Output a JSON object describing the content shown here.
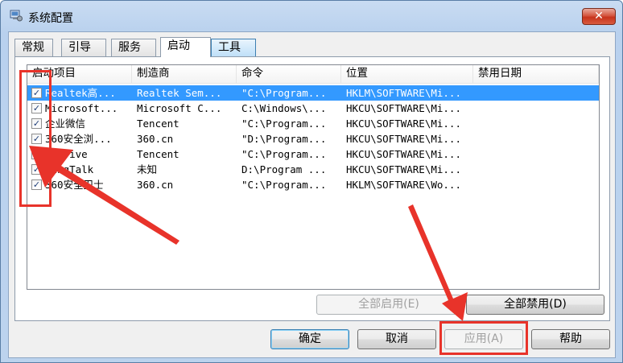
{
  "window": {
    "title": "系统配置",
    "close_label": "✕"
  },
  "tabs": [
    {
      "label": "常规"
    },
    {
      "label": "引导"
    },
    {
      "label": "服务"
    },
    {
      "label": "启动"
    },
    {
      "label": "工具"
    }
  ],
  "columns": [
    "启动项目",
    "制造商",
    "命令",
    "位置",
    "禁用日期"
  ],
  "rows": [
    {
      "item": "Realtek高...",
      "maker": "Realtek Sem...",
      "command": "\"C:\\Program...",
      "location": "HKLM\\SOFTWARE\\Mi...",
      "date": "",
      "checked": true,
      "selected": true
    },
    {
      "item": "Microsoft...",
      "maker": "Microsoft C...",
      "command": "C:\\Windows\\...",
      "location": "HKCU\\SOFTWARE\\Mi...",
      "date": "",
      "checked": true,
      "selected": false
    },
    {
      "item": "企业微信",
      "maker": "Tencent",
      "command": "\"C:\\Program...",
      "location": "HKCU\\SOFTWARE\\Mi...",
      "date": "",
      "checked": true,
      "selected": false
    },
    {
      "item": "360安全浏...",
      "maker": "360.cn",
      "command": "\"D:\\Program...",
      "location": "HKCU\\SOFTWARE\\Mi...",
      "date": "",
      "checked": true,
      "selected": false
    },
    {
      "item": "WXDrive",
      "maker": "Tencent",
      "command": "\"C:\\Program...",
      "location": "HKCU\\SOFTWARE\\Mi...",
      "date": "",
      "checked": true,
      "selected": false
    },
    {
      "item": "DingTalk",
      "maker": "未知",
      "command": "D:\\Program ...",
      "location": "HKCU\\SOFTWARE\\Mi...",
      "date": "",
      "checked": true,
      "selected": false
    },
    {
      "item": "360安全卫士",
      "maker": "360.cn",
      "command": "\"C:\\Program...",
      "location": "HKLM\\SOFTWARE\\Wo...",
      "date": "",
      "checked": true,
      "selected": false
    }
  ],
  "buttons": {
    "enable_all": "全部启用(E)",
    "disable_all": "全部禁用(D)",
    "ok": "确定",
    "cancel": "取消",
    "apply": "应用(A)",
    "help": "帮助"
  },
  "colors": {
    "annotation": "#e8332a",
    "selection": "#3399ff"
  }
}
